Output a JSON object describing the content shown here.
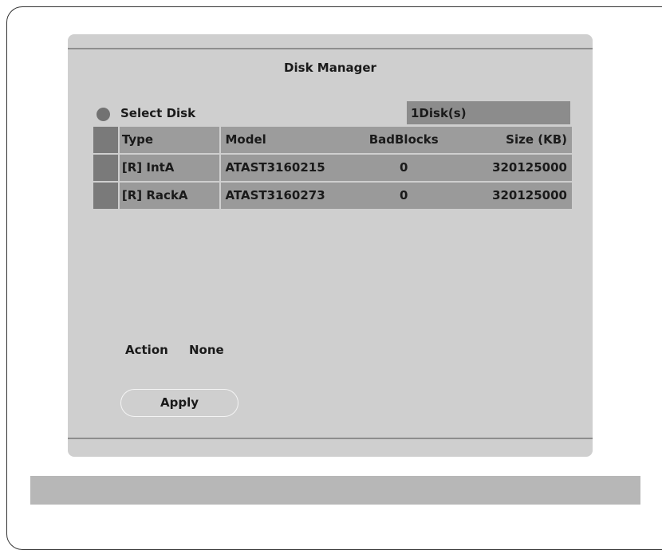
{
  "dialog": {
    "title": "Disk Manager",
    "select_disk_label": "Select Disk",
    "disk_count": "1Disk(s)"
  },
  "table": {
    "headers": [
      "Type",
      "Model",
      "BadBlocks",
      "Size (KB)"
    ],
    "rows": [
      [
        "[R] IntA",
        "ATAST3160215",
        "0",
        "320125000"
      ],
      [
        "[R] RackA",
        "ATAST3160273",
        "0",
        "320125000"
      ]
    ]
  },
  "action": {
    "label": "Action",
    "value": "None"
  },
  "apply_label": "Apply",
  "colors": {
    "panel": "#cfcfcf",
    "cell": "#9a9a9a",
    "selector": "#7a7a7a",
    "status_bar": "#b7b7b7"
  }
}
